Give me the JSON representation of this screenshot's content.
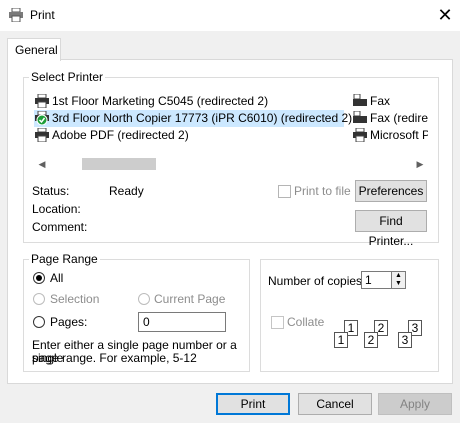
{
  "window": {
    "title": "Print",
    "close_glyph": "✕"
  },
  "tabs": [
    {
      "label": "General"
    }
  ],
  "select_printer": {
    "legend": "Select Printer",
    "printers_col1": [
      {
        "label": "1st Floor Marketing C5045 (redirected 2)",
        "icon": "printer-icon",
        "selected": false
      },
      {
        "label": "3rd Floor North Copier 17773 (iPR C6010) (redirected 2)",
        "icon": "default-printer-icon",
        "selected": true
      },
      {
        "label": "Adobe PDF (redirected 2)",
        "icon": "printer-icon",
        "selected": false
      }
    ],
    "printers_col2": [
      {
        "label": "Fax",
        "icon": "fax-icon"
      },
      {
        "label": "Fax (redirec",
        "icon": "fax-icon"
      },
      {
        "label": "Microsoft P",
        "icon": "printer-icon"
      }
    ],
    "status_label": "Status:",
    "status_value": "Ready",
    "location_label": "Location:",
    "comment_label": "Comment:",
    "print_to_file_label": "Print to file",
    "preferences_label": "Preferences",
    "find_printer_label": "Find Printer..."
  },
  "page_range": {
    "legend": "Page Range",
    "all_label": "All",
    "selection_label": "Selection",
    "current_page_label": "Current Page",
    "pages_label": "Pages:",
    "pages_value": "0",
    "help_line1": "Enter either a single page number or a single",
    "help_line2": "page range.  For example, 5-12"
  },
  "copies": {
    "number_label": "Number of copies:",
    "number_value": "1",
    "collate_label": "Collate",
    "collate_pages": [
      "1",
      "1",
      "2",
      "2",
      "3",
      "3"
    ]
  },
  "buttons": {
    "print": "Print",
    "cancel": "Cancel",
    "apply": "Apply"
  },
  "colors": {
    "selection_bg": "#cce8ff",
    "default_border": "#0078d7",
    "check_green": "#1e9e3a"
  }
}
